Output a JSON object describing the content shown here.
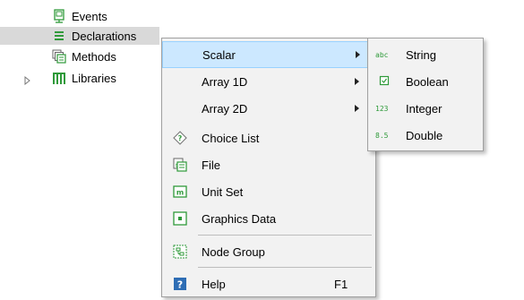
{
  "tree": {
    "items": [
      {
        "label": "Events",
        "icon": "events-icon"
      },
      {
        "label": "Declarations",
        "icon": "declarations-icon"
      },
      {
        "label": "Methods",
        "icon": "methods-icon"
      },
      {
        "label": "Libraries",
        "icon": "libraries-icon"
      }
    ]
  },
  "context_menu": {
    "items": [
      {
        "label": "Scalar",
        "has_submenu": true
      },
      {
        "label": "Array 1D",
        "has_submenu": true
      },
      {
        "label": "Array 2D",
        "has_submenu": true
      },
      {
        "label": "Choice List",
        "icon": "choice-list-icon"
      },
      {
        "label": "File",
        "icon": "file-icon"
      },
      {
        "label": "Unit Set",
        "icon": "unit-set-icon"
      },
      {
        "label": "Graphics Data",
        "icon": "graphics-data-icon"
      },
      {
        "label": "Node Group",
        "icon": "node-group-icon"
      },
      {
        "label": "Help",
        "icon": "help-icon",
        "shortcut": "F1"
      }
    ]
  },
  "scalar_submenu": {
    "items": [
      {
        "label": "String",
        "icon_text": "abc"
      },
      {
        "label": "Boolean",
        "icon": "checkbox-icon"
      },
      {
        "label": "Integer",
        "icon_text": "123"
      },
      {
        "label": "Double",
        "icon_text": "8.5"
      }
    ]
  },
  "colors": {
    "selection": "#d9d9d9",
    "menu_background": "#f2f2f2",
    "menu_highlight": "#cce8ff",
    "icon_green": "#2f9a3a",
    "help_blue": "#2e6db4"
  }
}
